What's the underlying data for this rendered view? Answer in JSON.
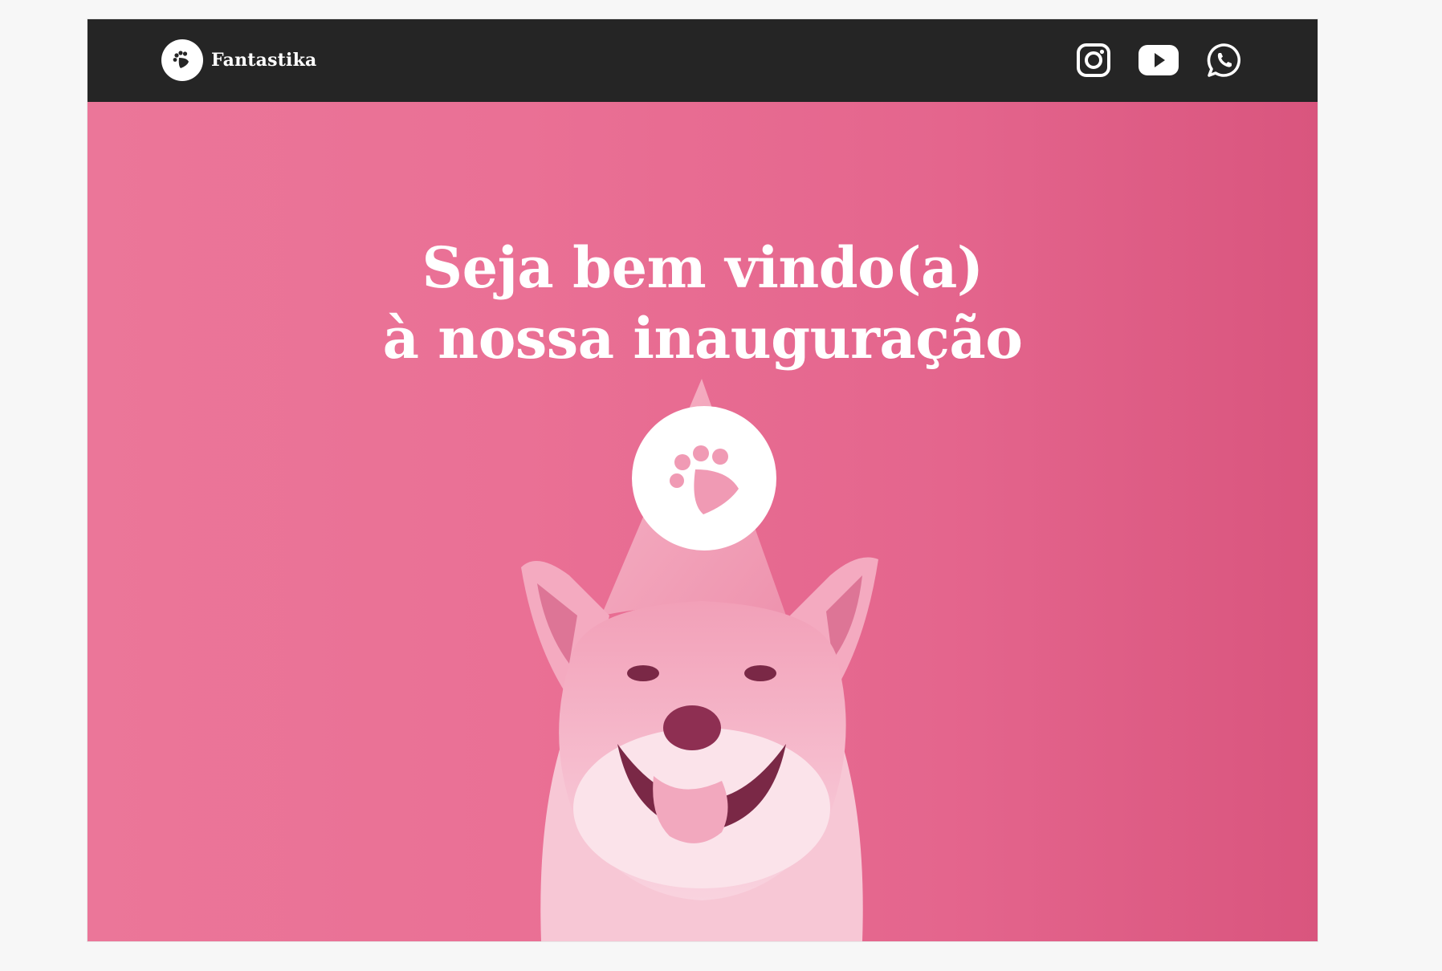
{
  "brand": {
    "name": "Fantastika",
    "logo_icon": "paw-icon"
  },
  "social": [
    {
      "name": "instagram",
      "icon": "instagram-icon"
    },
    {
      "name": "youtube",
      "icon": "youtube-icon"
    },
    {
      "name": "whatsapp",
      "icon": "whatsapp-icon"
    }
  ],
  "hero": {
    "title_line1": "Seja bem vindo(a)",
    "title_line2": "à nossa inauguração",
    "badge_icon": "paw-icon",
    "image": "dog-with-party-hat"
  },
  "colors": {
    "topbar": "#252525",
    "hero_pink": "#e46c91",
    "white": "#ffffff"
  }
}
